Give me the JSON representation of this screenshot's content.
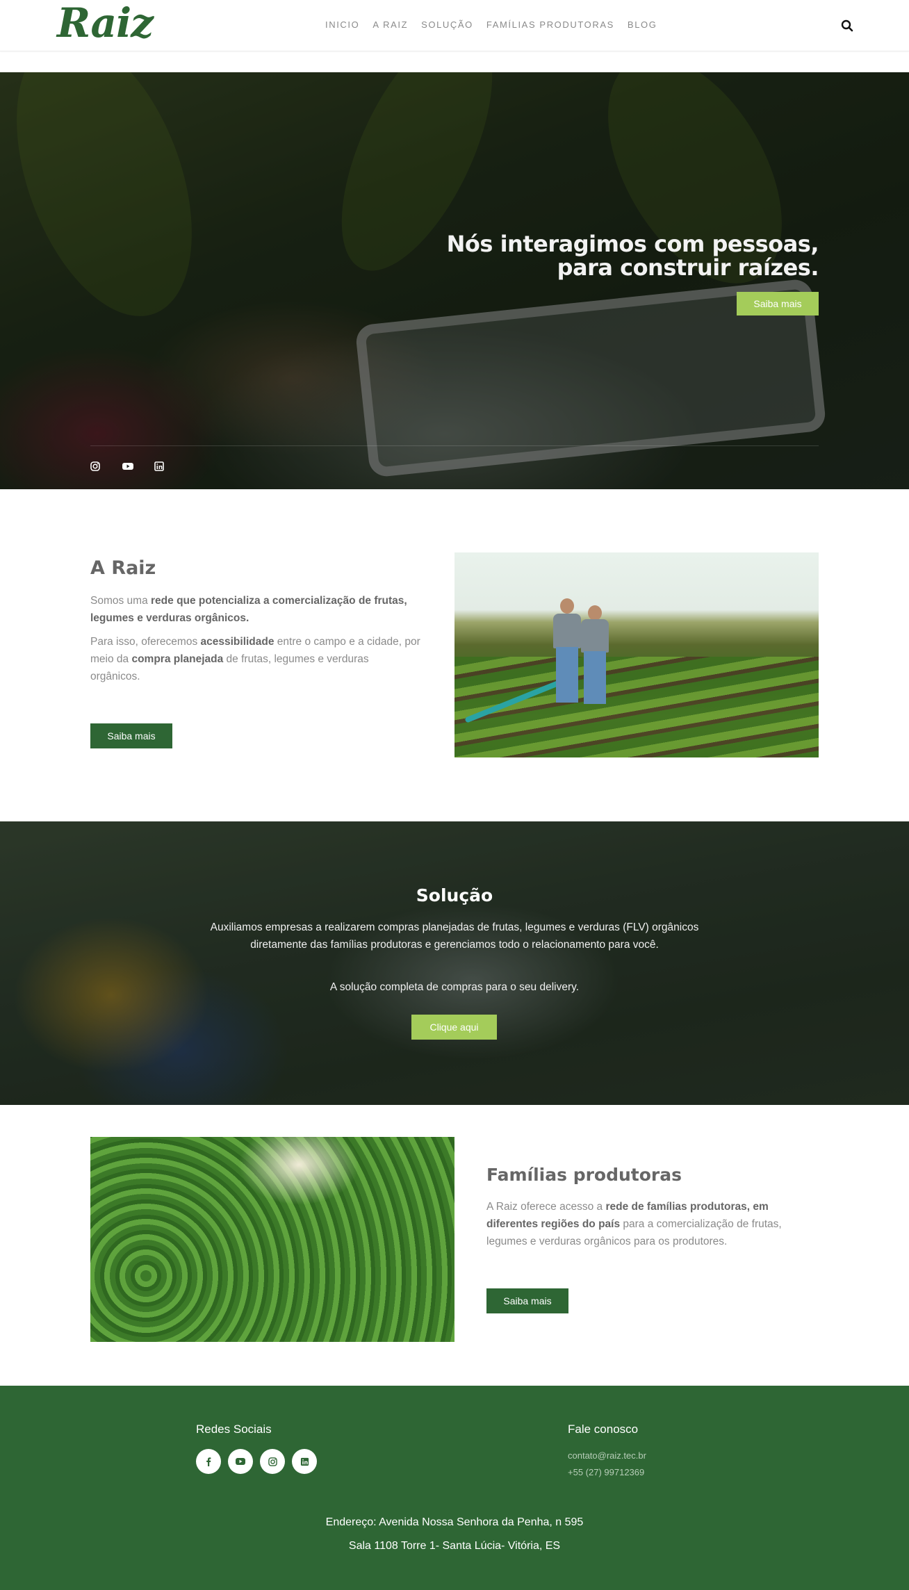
{
  "brand": {
    "logo_text": "Raiz",
    "color_primary": "#2e6634",
    "color_accent": "#a4cc5a"
  },
  "nav": {
    "items": [
      {
        "label": "INICIO"
      },
      {
        "label": "A RAIZ"
      },
      {
        "label": "SOLUÇÃO"
      },
      {
        "label": "FAMÍLIAS PRODUTORAS"
      },
      {
        "label": "BLOG"
      }
    ],
    "search_icon": "search-icon"
  },
  "hero": {
    "title_line1": "Nós interagimos com pessoas,",
    "title_line2": "para construir raízes.",
    "button_label": "Saiba mais",
    "social_icons": [
      "instagram-icon",
      "youtube-icon",
      "linkedin-icon"
    ]
  },
  "about": {
    "title": "A Raiz",
    "p1_a": "Somos uma ",
    "p1_b": "rede que potencializa a comercialização de frutas, legumes e verduras orgânicos.",
    "p2_a": "Para isso, oferecemos ",
    "p2_b": "acessibilidade",
    "p2_c": " entre o campo e a cidade, por meio da ",
    "p2_d": "compra planejada",
    "p2_e": " de frutas, legumes e verduras orgânicos.",
    "button_label": "Saiba mais"
  },
  "solution": {
    "title": "Solução",
    "p1": "Auxiliamos empresas a realizarem compras planejadas de frutas, legumes e verduras (FLV) orgânicos diretamente das famílias produtoras e gerenciamos todo o relacionamento para você.",
    "p2": "A solução completa de compras para o seu delivery.",
    "button_label": "Clique aqui"
  },
  "families": {
    "title": "Famílias produtoras",
    "p_a": "A Raiz oferece acesso a ",
    "p_b": "rede de famílias produtoras, em diferentes regiões do país",
    "p_c": " para a comercialização de  frutas, legumes e verduras orgânicos para os produtores.",
    "button_label": "Saiba mais"
  },
  "footer": {
    "social_title": "Redes Sociais",
    "social_icons": [
      "facebook-icon",
      "youtube-icon",
      "instagram-icon",
      "linkedin-icon"
    ],
    "contact_title": "Fale conosco",
    "email": "contato@raiz.tec.br",
    "phone": "+55 (27) 99712369",
    "address_line1": "Endereço: Avenida Nossa Senhora da Penha, n 595",
    "address_line2": "Sala 1108 Torre 1- Santa Lúcia- Vitória, ES"
  }
}
